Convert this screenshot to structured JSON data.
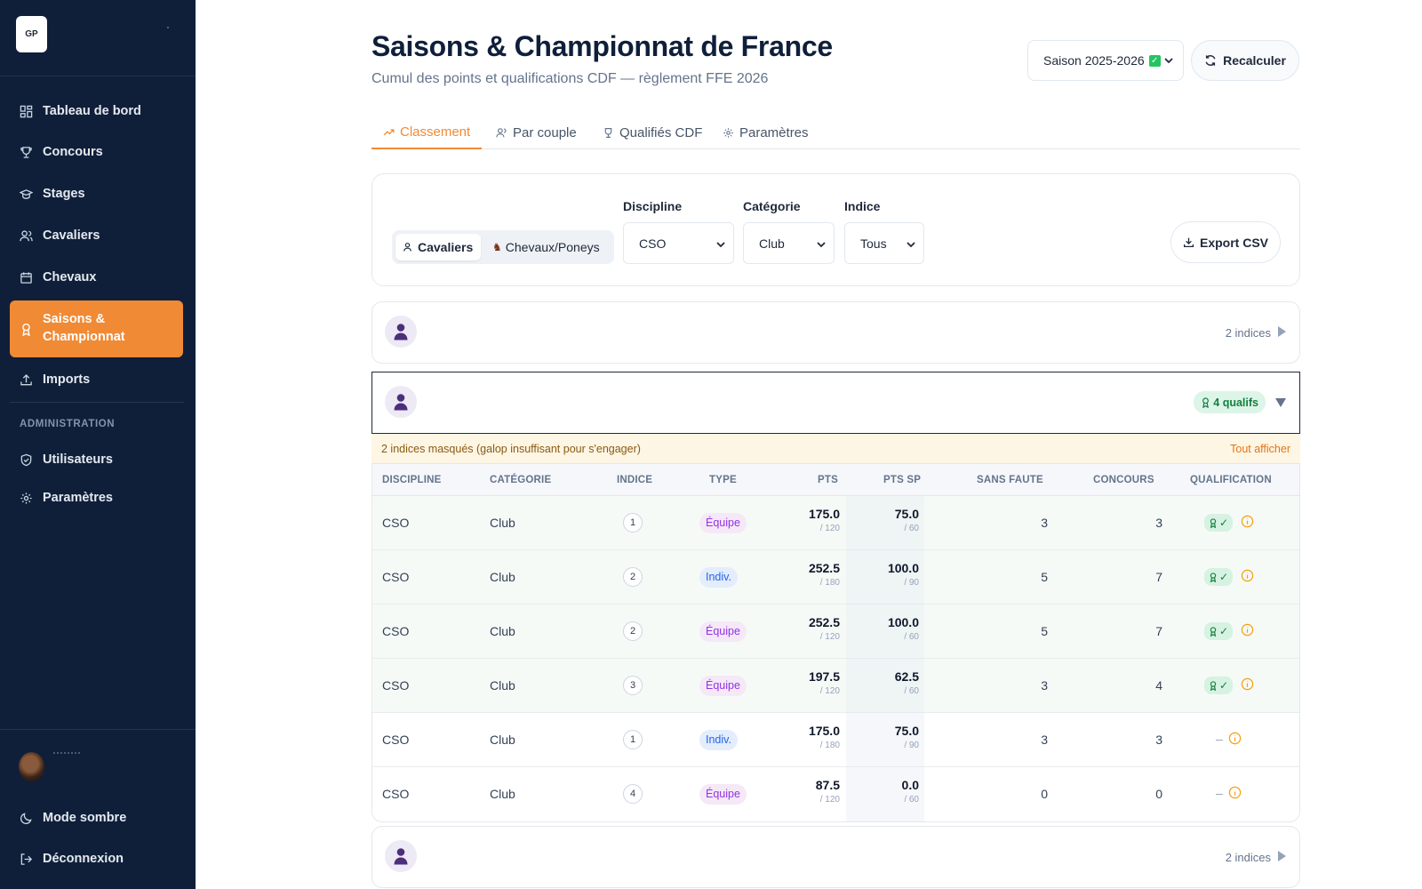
{
  "sidebar": {
    "logo_text": "GP",
    "nav": [
      {
        "label": "Tableau de bord",
        "icon": "dashboard-icon"
      },
      {
        "label": "Concours",
        "icon": "trophy-icon"
      },
      {
        "label": "Stages",
        "icon": "graduation-cap-icon"
      },
      {
        "label": "Cavaliers",
        "icon": "users-icon"
      },
      {
        "label": "Chevaux",
        "icon": "calendar-icon"
      },
      {
        "label": "Saisons & Championnat",
        "icon": "award-icon",
        "active": true
      },
      {
        "label": "Imports",
        "icon": "upload-icon"
      }
    ],
    "admin_section": "ADMINISTRATION",
    "admin_nav": [
      {
        "label": "Utilisateurs",
        "icon": "shield-icon"
      },
      {
        "label": "Paramètres",
        "icon": "gear-icon"
      }
    ],
    "dark_mode": "Mode sombre",
    "logout": "Déconnexion"
  },
  "header": {
    "title": "Saisons & Championnat de France",
    "subtitle": "Cumul des points et qualifications CDF — règlement FFE 2026",
    "season": "Saison 2025-2026",
    "recalc": "Recalculer"
  },
  "tabs": [
    {
      "label": "Classement",
      "active": true
    },
    {
      "label": "Par couple"
    },
    {
      "label": "Qualifiés CDF"
    },
    {
      "label": "Paramètres"
    }
  ],
  "filters": {
    "mode_riders": "Cavaliers",
    "mode_horses": "Chevaux/Poneys",
    "discipline_label": "Discipline",
    "discipline_value": "CSO",
    "category_label": "Catégorie",
    "category_value": "Club",
    "index_label": "Indice",
    "index_value": "Tous",
    "export": "Export CSV"
  },
  "riders": [
    {
      "meta": "2 indices",
      "expanded": false
    },
    {
      "qualifs": "4 qualifs",
      "expanded": true
    },
    {
      "meta": "2 indices",
      "expanded": false
    }
  ],
  "expanded": {
    "warning": "2 indices masqués (galop insuffisant pour s'engager)",
    "show_all": "Tout afficher",
    "columns": [
      "DISCIPLINE",
      "CATÉGORIE",
      "INDICE",
      "TYPE",
      "PTS",
      "PTS SP",
      "SANS FAUTE",
      "CONCOURS",
      "QUALIFICATION"
    ],
    "rows": [
      {
        "discipline": "CSO",
        "category": "Club",
        "index": "1",
        "type": "Équipe",
        "type_kind": "eq",
        "pts": "175.0",
        "pts_max": "/ 120",
        "sp": "75.0",
        "sp_max": "/ 60",
        "sans_faute": "3",
        "concours": "3",
        "qualified": true
      },
      {
        "discipline": "CSO",
        "category": "Club",
        "index": "2",
        "type": "Indiv.",
        "type_kind": "ind",
        "pts": "252.5",
        "pts_max": "/ 180",
        "sp": "100.0",
        "sp_max": "/ 90",
        "sans_faute": "5",
        "concours": "7",
        "qualified": true
      },
      {
        "discipline": "CSO",
        "category": "Club",
        "index": "2",
        "type": "Équipe",
        "type_kind": "eq",
        "pts": "252.5",
        "pts_max": "/ 120",
        "sp": "100.0",
        "sp_max": "/ 60",
        "sans_faute": "5",
        "concours": "7",
        "qualified": true
      },
      {
        "discipline": "CSO",
        "category": "Club",
        "index": "3",
        "type": "Équipe",
        "type_kind": "eq",
        "pts": "197.5",
        "pts_max": "/ 120",
        "sp": "62.5",
        "sp_max": "/ 60",
        "sans_faute": "3",
        "concours": "4",
        "qualified": true
      },
      {
        "discipline": "CSO",
        "category": "Club",
        "index": "1",
        "type": "Indiv.",
        "type_kind": "ind",
        "pts": "175.0",
        "pts_max": "/ 180",
        "sp": "75.0",
        "sp_max": "/ 90",
        "sans_faute": "3",
        "concours": "3",
        "qualified": false
      },
      {
        "discipline": "CSO",
        "category": "Club",
        "index": "4",
        "type": "Équipe",
        "type_kind": "eq",
        "pts": "87.5",
        "pts_max": "/ 120",
        "sp": "0.0",
        "sp_max": "/ 60",
        "sans_faute": "0",
        "concours": "0",
        "qualified": false
      }
    ],
    "qualified_mark": "✓",
    "not_qualified_mark": "–"
  },
  "colors": {
    "sidebar_bg": "#0f1f3a",
    "accent": "#f08a35",
    "qualified_green": "#15803d",
    "warning_bg": "#fef6e4"
  }
}
